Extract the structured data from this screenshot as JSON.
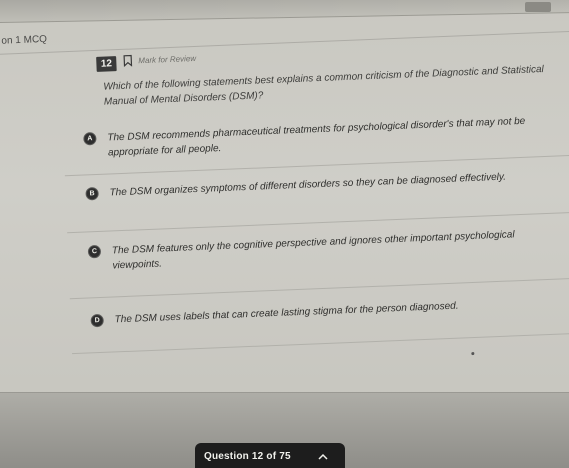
{
  "header": {
    "section_label": "on 1 MCQ",
    "question_number": "12",
    "mark_review_label": "Mark for Review"
  },
  "question": {
    "stem": "Which of the following statements best explains a common criticism of the Diagnostic and Statistical Manual of Mental Disorders (DSM)?",
    "options": [
      {
        "letter": "A",
        "text": "The DSM recommends pharmaceutical treatments for psychological disorder's that may not be appropriate for all people."
      },
      {
        "letter": "B",
        "text": "The DSM organizes symptoms of different disorders so they can be diagnosed effectively."
      },
      {
        "letter": "C",
        "text": "The DSM features only the cognitive perspective and ignores other important psychological viewpoints."
      },
      {
        "letter": "D",
        "text": "The DSM uses labels that can create lasting stigma for the person diagnosed."
      }
    ]
  },
  "footer": {
    "question_counter": "Question 12 of 75"
  },
  "icons": {
    "bookmark": "bookmark-icon",
    "chevron": "chevron-up-icon"
  }
}
